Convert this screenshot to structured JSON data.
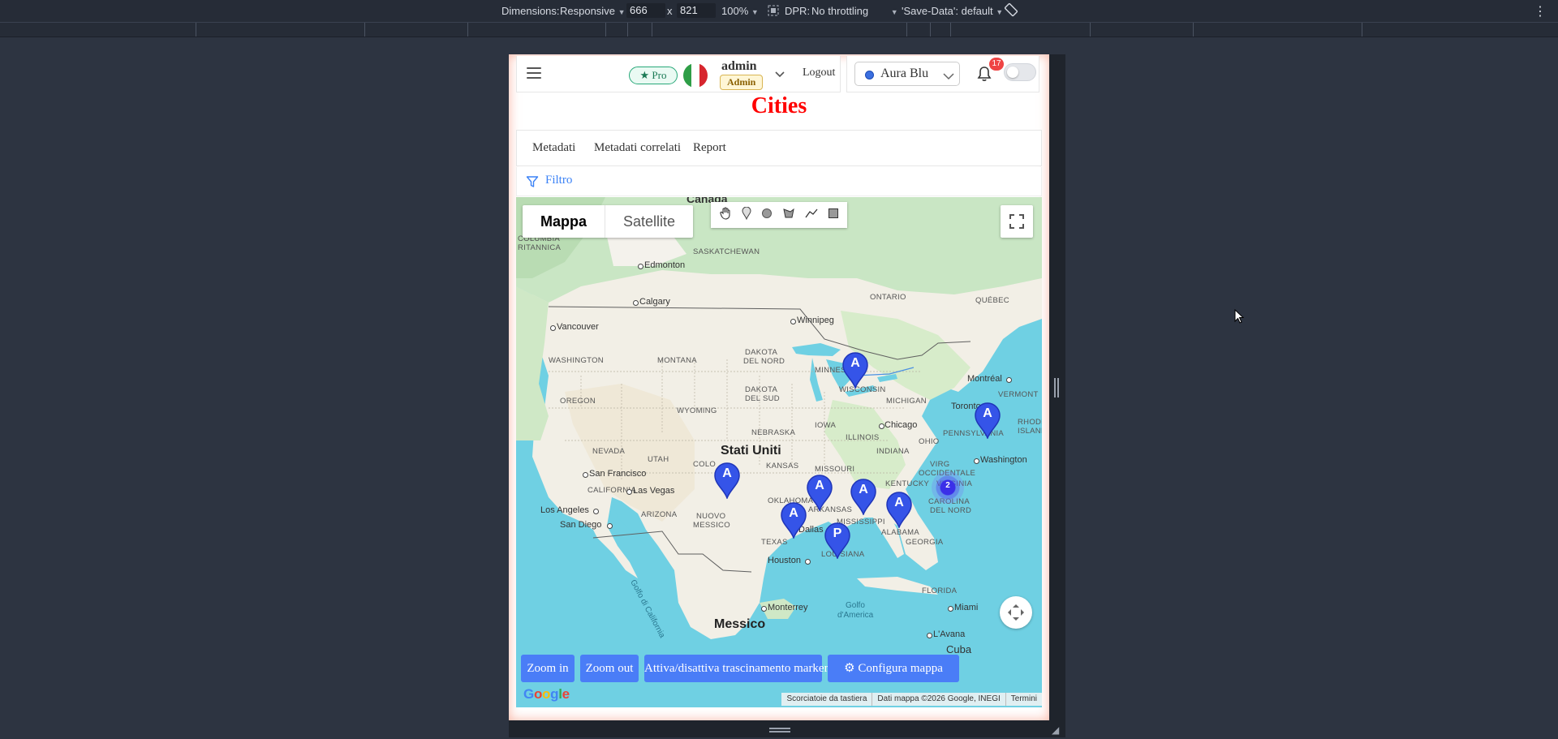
{
  "devtools": {
    "dimensions_label": "Dimensions:",
    "dimensions_mode": "Responsive",
    "width": "666",
    "times": "x",
    "height": "821",
    "zoom": "100%",
    "dpr_label": "DPR:",
    "throttling": "No throttling",
    "save_data": "'Save-Data': default"
  },
  "header": {
    "pro_label": "Pro",
    "user_name": "admin",
    "role": "Admin",
    "logout_label": "Logout",
    "theme_label": "Aura Blu",
    "notification_count": "17"
  },
  "page": {
    "title": "Cities"
  },
  "tabs": [
    {
      "label": "Metadati"
    },
    {
      "label": "Metadati correlati"
    },
    {
      "label": "Report"
    }
  ],
  "filter": {
    "label": "Filtro"
  },
  "map": {
    "map_type_options": [
      "Mappa",
      "Satellite"
    ],
    "selected_map_type": "Mappa",
    "buttons": {
      "zoom_in": "Zoom in",
      "zoom_out": "Zoom out",
      "toggle_drag": "Attiva/disattiva trascinamento marker",
      "configure": "Configura mappa"
    },
    "attribution": {
      "shortcuts": "Scorciatoie da tastiera",
      "data": "Dati mappa ©2026 Google, INEGI",
      "terms": "Termini"
    },
    "google_logo": "Google",
    "cluster_count": "2",
    "markers": [
      "A",
      "A",
      "A",
      "A",
      "A",
      "A",
      "A",
      "A",
      "P"
    ],
    "labels": {
      "canada": "Canada",
      "columbia": "COLUMBIA",
      "britannica": "RITANNICA",
      "saskatchewan": "SASKATCHEWAN",
      "edmonton": "Edmonton",
      "calgary": "Calgary",
      "vancouver": "Vancouver",
      "winnipeg": "Winnipeg",
      "ontario": "ONTARIO",
      "quebec": "QUÉBEC",
      "washington_state": "WASHINGTON",
      "montana": "MONTANA",
      "north_dakota_1": "DAKOTA",
      "north_dakota_2": "DEL NORD",
      "minnesota": "MINNESOTA",
      "oregon": "OREGON",
      "south_dakota_1": "DAKOTA",
      "south_dakota_2": "DEL SUD",
      "wisconsin": "WISCONSIN",
      "wyoming": "WYOMING",
      "michigan": "MICHIGAN",
      "montreal": "Montréal",
      "vermont": "VERMONT",
      "toronto": "Toronto",
      "rhode_1": "RHODE",
      "rhode_2": "ISLAND",
      "nebraska": "NEBRASKA",
      "iowa": "IOWA",
      "illinois": "ILLINOIS",
      "chicago": "Chicago",
      "ohio": "OHIO",
      "pennsylvania": "PENNSYLVANIA",
      "nevada": "NEVADA",
      "utah": "UTAH",
      "stati_uniti": "Stati Uniti",
      "colo": "COLO",
      "kansas": "KANSAS",
      "missouri": "MISSOURI",
      "indiana": "INDIANA",
      "virginia_occ_1": "VIRG",
      "virginia_occ_2": "OCCIDENTALE",
      "washington_city": "Washington",
      "virginia": "VIRGINIA",
      "san_francisco": "San Francisco",
      "california": "CALIFORNIA",
      "las_vegas": "Las Vegas",
      "kentucky": "KENTUCKY",
      "oklahoma": "OKLAHOMA",
      "arkansas": "ARKANSAS",
      "carolina_1": "CAROLINA",
      "carolina_2": "DEL NORD",
      "arizona": "ARIZONA",
      "los_angeles": "Los Angeles",
      "nuovo_1": "NUOVO",
      "nuovo_2": "MESSICO",
      "mississippi": "MISSISSIPPI",
      "alabama": "ALABAMA",
      "san_diego": "San Diego",
      "texas": "TEXAS",
      "dallas": "Dallas",
      "georgia": "GEORGIA",
      "louisiana": "LOUISIANA",
      "houston": "Houston",
      "golfo_california": "Golfo di California",
      "florida": "FLORIDA",
      "monterrey": "Monterrey",
      "golfo_1": "Golfo",
      "golfo_2": "d'America",
      "miami": "Miami",
      "messico": "Messico",
      "lavana": "L'Avana",
      "cuba": "Cuba"
    }
  }
}
